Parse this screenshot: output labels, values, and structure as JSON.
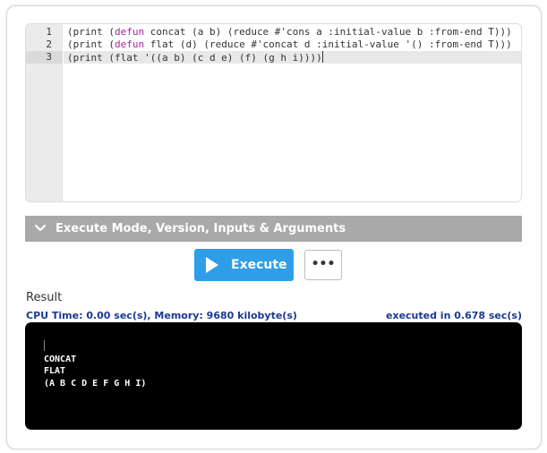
{
  "editor": {
    "lines": [
      {
        "number": "1",
        "pre": "(print (",
        "keyword": "defun",
        "post": " concat (a b) (reduce #'cons a :initial-value b :from-end T)))"
      },
      {
        "number": "2",
        "pre": "(print (",
        "keyword": "defun",
        "post": " flat (d) (reduce #'concat d :initial-value '() :from-end T)))"
      },
      {
        "number": "3",
        "pre": "(print (flat '((a b) (c d e) (f) (g h i))))",
        "keyword": "",
        "post": ""
      }
    ]
  },
  "exec_bar": {
    "label": "Execute Mode, Version, Inputs & Arguments"
  },
  "execute_button": {
    "label": "Execute"
  },
  "more_button": {
    "label": "•••"
  },
  "result": {
    "title": "Result",
    "stats": "CPU Time: 0.00 sec(s), Memory: 9680 kilobyte(s)",
    "executed": "executed in 0.678 sec(s)",
    "output_lines": [
      "CONCAT",
      "FLAT",
      "(A B C D E F G H I)"
    ]
  },
  "colors": {
    "accent": "#2f9ee8",
    "keyword": "#a626a4",
    "stats": "#1a3a8f",
    "bar": "#a9a9a9"
  }
}
